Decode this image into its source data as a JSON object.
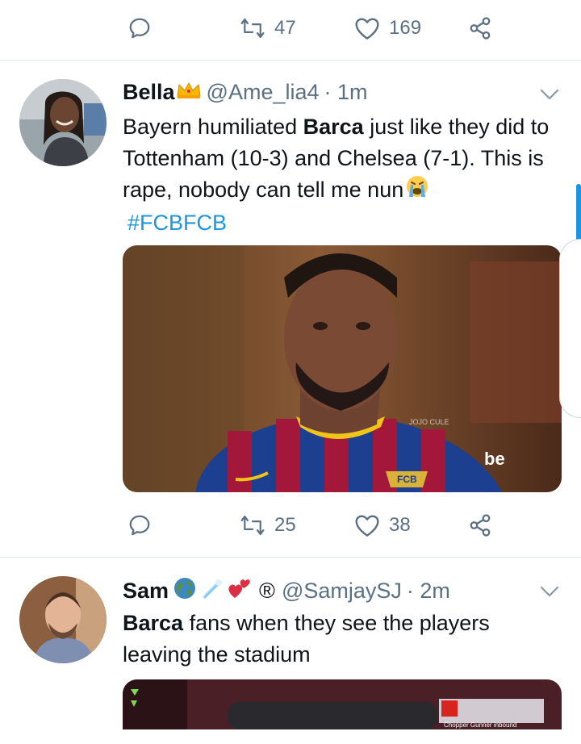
{
  "top_actions": {
    "retweets": "47",
    "likes": "169"
  },
  "tweets": [
    {
      "name": "Bella",
      "handle": "@Ame_lia4",
      "time": "· 1m",
      "text_1": "Bayern humiliated ",
      "text_bold": "Barca",
      "text_2": " just like they did to Tottenham (10-3) and Chelsea (7-1). This is rape, nobody can tell me nun",
      "hashtag": "#FCBFCB",
      "media_watermark": "JOJO CULE",
      "media_shirt_text": "be",
      "retweets": "25",
      "likes": "38"
    },
    {
      "name": "Sam",
      "handle": "@SamjaySJ",
      "time": "· 2m",
      "registered_mark": "®",
      "text_bold": "Barca",
      "text_1": " fans when they see the players leaving the stadium",
      "media_caption": "Chopper Gunner inbound"
    }
  ],
  "colors": {
    "accent": "#1b95e0",
    "muted": "#5b7083",
    "divider": "#e1e8ed"
  },
  "icons": [
    "reply-icon",
    "retweet-icon",
    "like-icon",
    "share-icon",
    "caret-down-icon",
    "crown-emoji",
    "crying-emoji",
    "globe-emoji",
    "comet-emoji",
    "hearts-emoji"
  ]
}
